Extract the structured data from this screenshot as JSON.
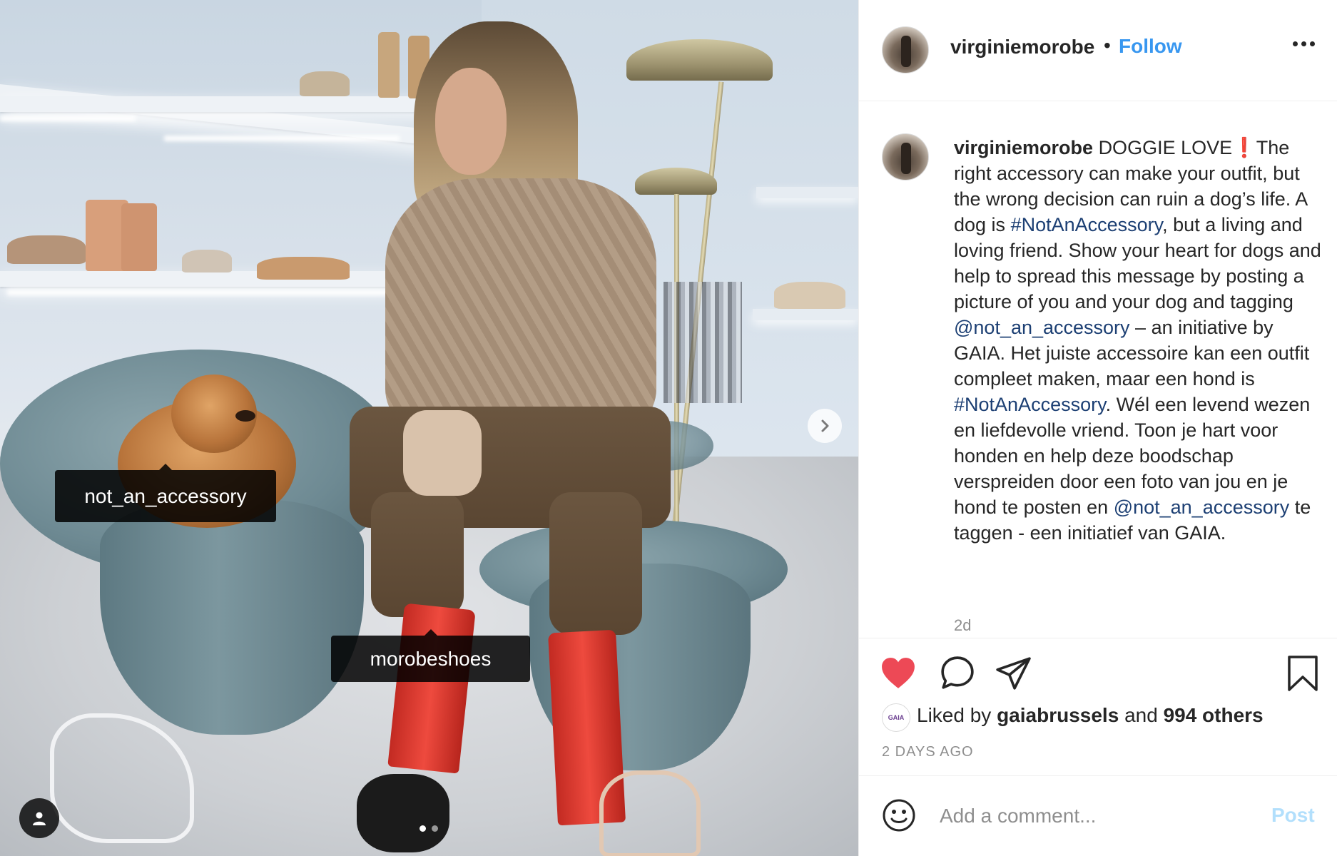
{
  "photo": {
    "tags": [
      {
        "label": "not_an_accessory"
      },
      {
        "label": "morobeshoes"
      }
    ],
    "next_icon": "chevron-right-icon",
    "user_tag_icon": "person-icon",
    "carousel": {
      "count": 2,
      "active": 1
    }
  },
  "header": {
    "username": "virginiemorobe",
    "separator": "•",
    "follow_label": "Follow",
    "more_icon": "more-options-icon"
  },
  "caption": {
    "username": "virginiemorobe",
    "segments": [
      {
        "text": "DOGGIE LOVE❗️The right accessory can make your outfit, but the wrong decision can ruin a dog’s life. A dog is ",
        "link": false
      },
      {
        "text": "#NotAnAccessory",
        "link": true
      },
      {
        "text": ", but a living and loving friend. Show your heart for dogs and help to spread this message by posting a picture of you and your dog and tagging ",
        "link": false
      },
      {
        "text": "@not_an_accessory",
        "link": true
      },
      {
        "text": " – an initiative by GAIA. Het juiste accessoire kan een outfit compleet maken, maar een hond is ",
        "link": false
      },
      {
        "text": "#NotAnAccessory",
        "link": true
      },
      {
        "text": ". Wél een levend wezen en liefdevolle vriend. Toon je hart voor honden en help deze boodschap verspreiden door een foto van jou en je hond te posten en ",
        "link": false
      },
      {
        "text": "@not_an_accessory",
        "link": true
      },
      {
        "text": " te taggen - een initiatief van GAIA.",
        "link": false
      }
    ],
    "time": "2d"
  },
  "actions": {
    "like_icon": "heart-filled-icon",
    "comment_icon": "comment-icon",
    "share_icon": "share-icon",
    "save_icon": "bookmark-icon",
    "liked_color": "#ed4956"
  },
  "likes": {
    "avatar_text": "GAIA",
    "prefix": "Liked by",
    "first_user": "gaiabrussels",
    "joiner": "and",
    "others": "994 others"
  },
  "timestamp": "2 DAYS AGO",
  "comment_box": {
    "emoji_icon": "emoji-icon",
    "placeholder": "Add a comment...",
    "post_label": "Post"
  }
}
